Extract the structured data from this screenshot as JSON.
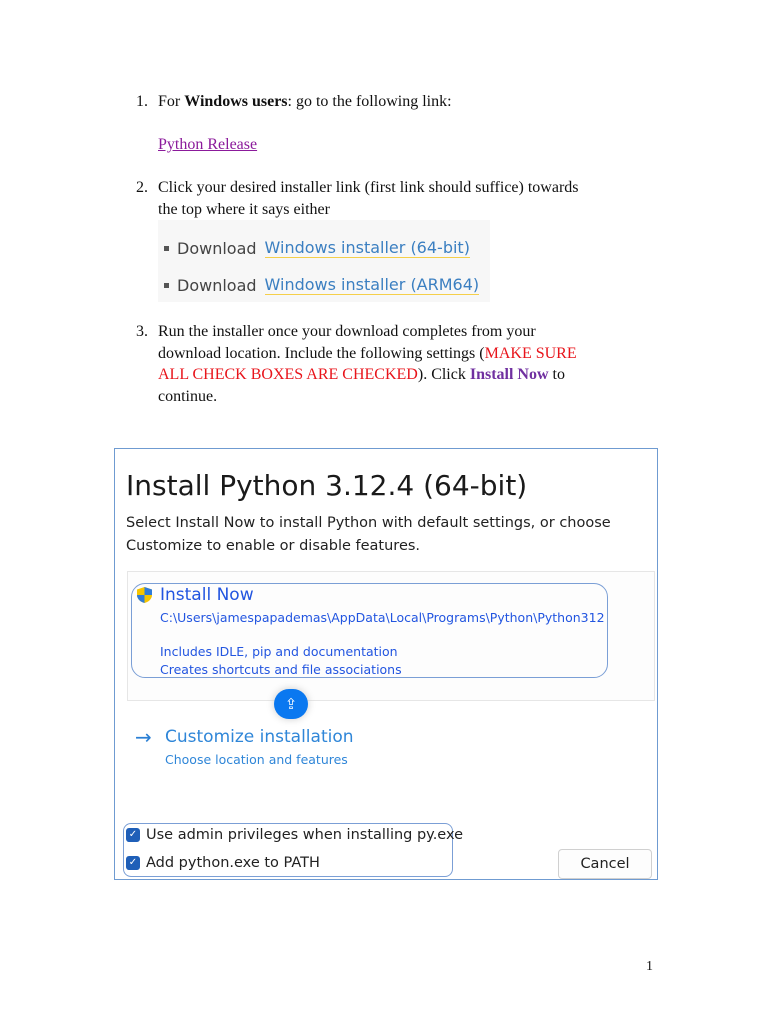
{
  "steps": [
    {
      "number": "1.",
      "pre": "For ",
      "bold": "Windows users",
      "post": ": go to the following link:",
      "link": "Python Release"
    },
    {
      "number": "2.",
      "line1": "Click your desired installer link (first link should suffice) towards",
      "line2": "the top where it says either",
      "downloads": [
        {
          "prefix": "Download",
          "link": "Windows installer (64-bit)"
        },
        {
          "prefix": "Download",
          "link": "Windows installer (ARM64)"
        }
      ]
    },
    {
      "number": "3.",
      "line1": "Run the installer once your download completes from your",
      "line2": "download location. Include the following settings (",
      "warn1": "MAKE SURE",
      "warn2": "ALL CHECK BOXES ARE CHECKED",
      "line3_post": ").  Click ",
      "install_now": "Install Now",
      "line3_end": " to",
      "line4": "continue."
    }
  ],
  "installer": {
    "title": "Install Python 3.12.4 (64-bit)",
    "subtitle1": "Select Install Now to install Python with default settings, or choose",
    "subtitle2": "Customize to enable or disable features.",
    "install_now": "Install Now",
    "path": "C:\\Users\\jamespapademas\\AppData\\Local\\Programs\\Python\\Python312",
    "includes": "Includes IDLE, pip and documentation",
    "creates": "Creates shortcuts and file associations",
    "customize": "Customize installation",
    "customize_sub": "Choose location and features",
    "checkbox_admin": "Use admin privileges when installing py.exe",
    "checkbox_path": "Add python.exe to PATH",
    "cancel": "Cancel"
  },
  "page_number": "1"
}
